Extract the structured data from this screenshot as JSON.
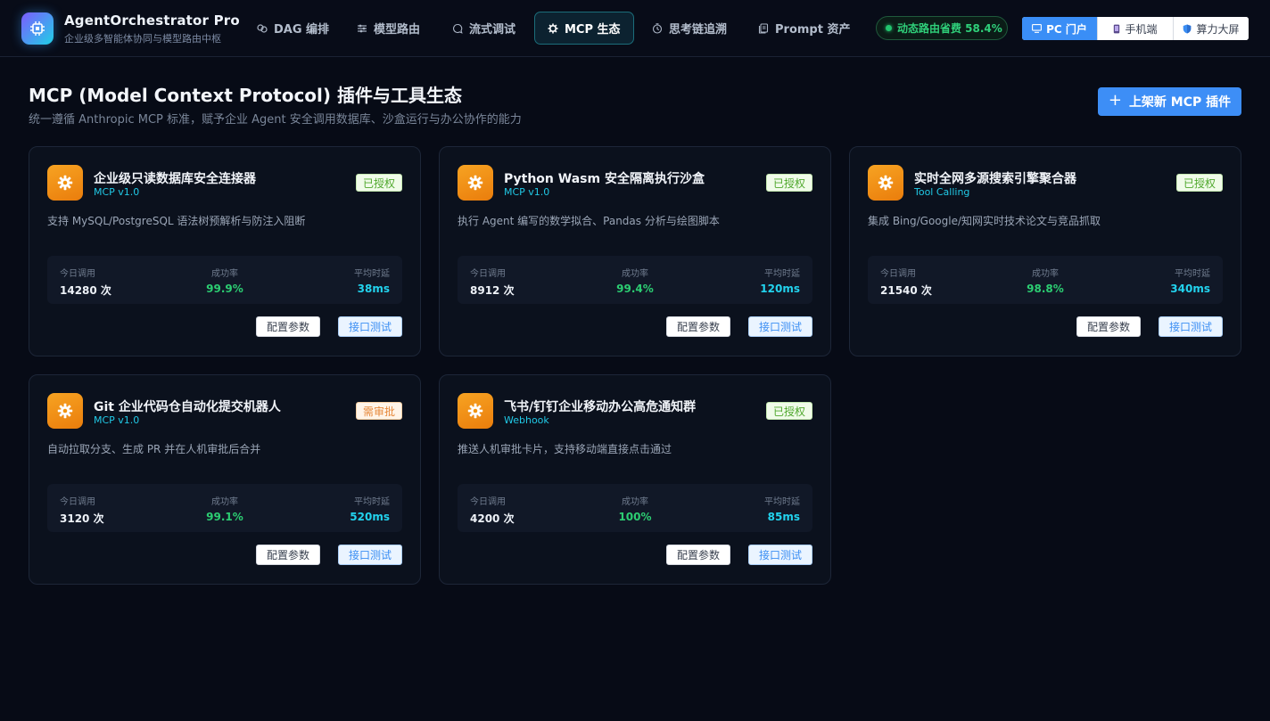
{
  "app": {
    "title": "AgentOrchestrator Pro",
    "subtitle": "企业级多智能体协同与模型路由中枢"
  },
  "nav": {
    "tabs": [
      {
        "label": "DAG 编排",
        "icon": "workflow-icon",
        "active": false
      },
      {
        "label": "模型路由",
        "icon": "sliders-icon",
        "active": false
      },
      {
        "label": "流式调试",
        "icon": "chat-bubble-icon",
        "active": false
      },
      {
        "label": "MCP 生态",
        "icon": "gear-icon",
        "active": true
      },
      {
        "label": "思考链追溯",
        "icon": "clock-icon",
        "active": false
      },
      {
        "label": "Prompt 资产",
        "icon": "document-icon",
        "active": false
      }
    ]
  },
  "status": {
    "saving_label": "动态路由省费 58.4%",
    "color": "#2fd07a"
  },
  "view_switch": {
    "options": [
      {
        "label": "PC 门户",
        "icon": "monitor-icon",
        "active": true
      },
      {
        "label": "手机端",
        "icon": "phone-icon",
        "active": false
      },
      {
        "label": "算力大屏",
        "icon": "shield-icon",
        "active": false
      }
    ]
  },
  "page": {
    "title": "MCP (Model Context Protocol) 插件与工具生态",
    "description": "统一遵循 Anthropic MCP 标准，赋予企业 Agent 安全调用数据库、沙盒运行与办公协作的能力",
    "primary_button": "上架新 MCP 插件"
  },
  "card_labels": {
    "calls": "今日调用",
    "success": "成功率",
    "latency": "平均时延",
    "config_button": "配置参数",
    "test_button": "接口测试"
  },
  "plugins": [
    {
      "name": "企业级只读数据库安全连接器",
      "protocol": "MCP v1.0",
      "status": "已授权",
      "status_type": "ok",
      "description": "支持 MySQL/PostgreSQL 语法树预解析与防注入阻断",
      "calls": "14280 次",
      "success_rate": "99.9%",
      "latency": "38ms"
    },
    {
      "name": "Python Wasm 安全隔离执行沙盒",
      "protocol": "MCP v1.0",
      "status": "已授权",
      "status_type": "ok",
      "description": "执行 Agent 编写的数学拟合、Pandas 分析与绘图脚本",
      "calls": "8912 次",
      "success_rate": "99.4%",
      "latency": "120ms"
    },
    {
      "name": "实时全网多源搜索引擎聚合器",
      "protocol": "Tool Calling",
      "status": "已授权",
      "status_type": "ok",
      "description": "集成 Bing/Google/知网实时技术论文与竞品抓取",
      "calls": "21540 次",
      "success_rate": "98.8%",
      "latency": "340ms"
    },
    {
      "name": "Git 企业代码仓自动化提交机器人",
      "protocol": "MCP v1.0",
      "status": "需审批",
      "status_type": "warn",
      "description": "自动拉取分支、生成 PR 并在人机审批后合并",
      "calls": "3120 次",
      "success_rate": "99.1%",
      "latency": "520ms"
    },
    {
      "name": "飞书/钉钉企业移动办公高危通知群",
      "protocol": "Webhook",
      "status": "已授权",
      "status_type": "ok",
      "description": "推送人机审批卡片，支持移动端直接点击通过",
      "calls": "4200 次",
      "success_rate": "100%",
      "latency": "85ms"
    }
  ]
}
